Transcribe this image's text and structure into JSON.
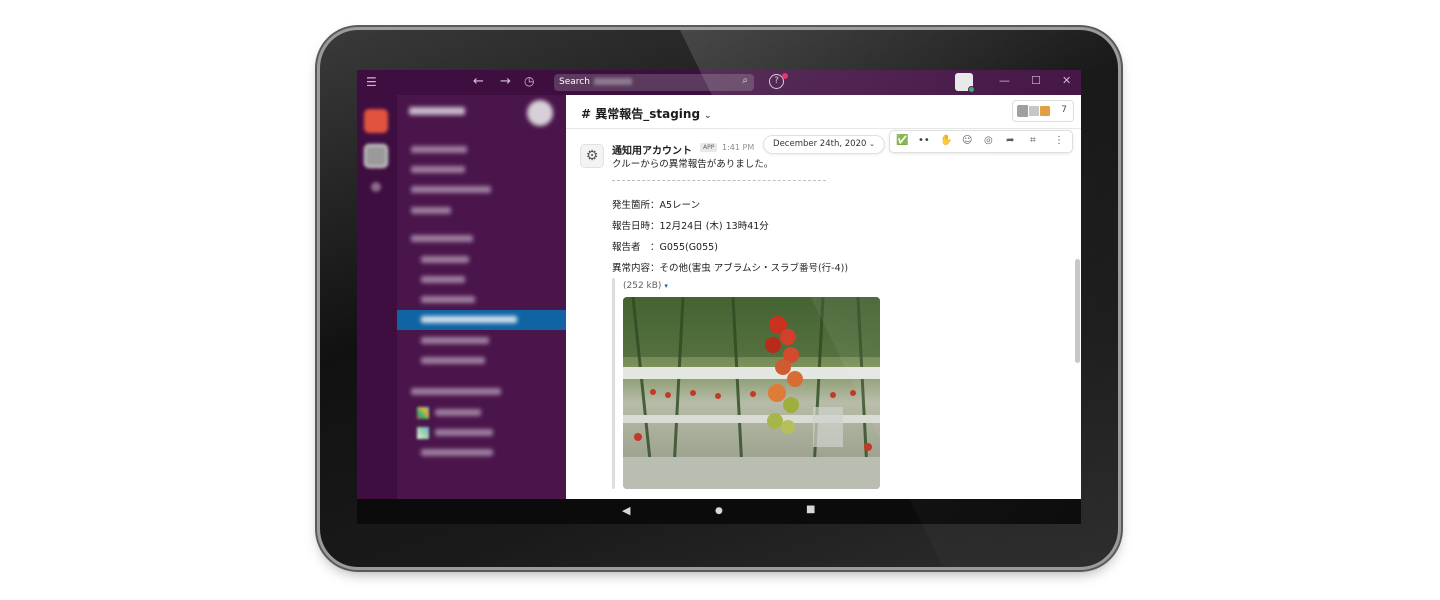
{
  "window": {
    "search_label": "Search",
    "help_label": "?"
  },
  "sidebar": {
    "active_item_index": 6
  },
  "channel": {
    "title": "# 異常報告_staging",
    "member_count": "7"
  },
  "message": {
    "sender": "通知用アカウント",
    "app_badge": "APP",
    "time": "1:41 PM",
    "date_pill": "December 24th, 2020",
    "intro": "クルーからの異常報告がありました。",
    "location": "発生箇所：A5レーン",
    "datetime": "報告日時：12月24日 (木) 13時41分",
    "reporter": "報告者　：G055(G055)",
    "content": "異常内容：その他(害虫 アブラムシ・スラブ番号(行-4))",
    "file_size": "(252 kB)"
  },
  "colors": {
    "titlebar": "#3f0e40",
    "sidebar": "#4a154b",
    "active_channel": "#1164a3"
  },
  "icons": {
    "menu": "hamburger-icon",
    "back": "arrow-left-icon",
    "forward": "arrow-right-icon",
    "history": "clock-icon",
    "search": "search-icon",
    "help": "help-icon"
  }
}
